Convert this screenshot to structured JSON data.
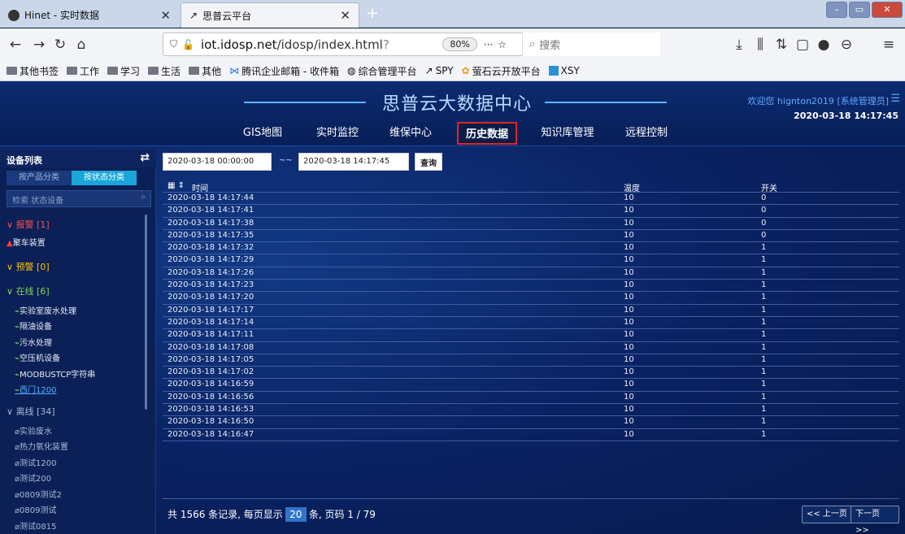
{
  "browser": {
    "tabs": [
      {
        "title": "Hinet - 实时数据"
      },
      {
        "title": "思普云平台"
      }
    ],
    "url_host": "iot.idosp.net",
    "url_path": "/idosp/index.html",
    "url_fade": "?",
    "zoom": "80%",
    "search_placeholder": "搜索",
    "bookmarks": [
      "其他书签",
      "工作",
      "学习",
      "生活",
      "其他",
      "腾讯企业邮箱 - 收件箱",
      "综合管理平台",
      "SPY",
      "萤石云开放平台",
      "XSY"
    ]
  },
  "header": {
    "title": "思普云大数据中心",
    "welcome": "欢迎您 hignton2019 [系统管理员]",
    "datetime": "2020-03-18 14:17:45"
  },
  "menu": [
    "GIS地图",
    "实时监控",
    "维保中心",
    "历史数据",
    "知识库管理",
    "远程控制"
  ],
  "sidebar": {
    "title": "设备列表",
    "seg": [
      "按产品分类",
      "按状态分类"
    ],
    "search_placeholder": "检索 状态设备",
    "groups": [
      {
        "label": "报警 [1]",
        "color": "#ff4d4d",
        "items": [
          "聚车装置"
        ]
      },
      {
        "label": "预警 [0]",
        "color": "#ffc107",
        "items": []
      },
      {
        "label": "在线 [6]",
        "color": "#7ed957",
        "items": [
          "实验室废水处理",
          "隔油设备",
          "污水处理",
          "空压机设备",
          "MODBUSTCP字符串",
          "西门1200"
        ]
      },
      {
        "label": "离线 [34]",
        "color": "#aab8d2",
        "items": [
          "实验废水",
          "热力氧化装置",
          "测试1200",
          "测试200",
          "0809测试2",
          "0809测试",
          "测试0815"
        ]
      }
    ]
  },
  "query": {
    "start": "2020-03-18 00:00:00",
    "sep": "~~",
    "end": "2020-03-18 14:17:45",
    "button": "查询"
  },
  "table": {
    "headers": [
      "时间",
      "温度",
      "开关"
    ],
    "rows": [
      [
        "2020-03-18 14:17:44",
        "10",
        "0"
      ],
      [
        "2020-03-18 14:17:41",
        "10",
        "0"
      ],
      [
        "2020-03-18 14:17:38",
        "10",
        "0"
      ],
      [
        "2020-03-18 14:17:35",
        "10",
        "0"
      ],
      [
        "2020-03-18 14:17:32",
        "10",
        "1"
      ],
      [
        "2020-03-18 14:17:29",
        "10",
        "1"
      ],
      [
        "2020-03-18 14:17:26",
        "10",
        "1"
      ],
      [
        "2020-03-18 14:17:23",
        "10",
        "1"
      ],
      [
        "2020-03-18 14:17:20",
        "10",
        "1"
      ],
      [
        "2020-03-18 14:17:17",
        "10",
        "1"
      ],
      [
        "2020-03-18 14:17:14",
        "10",
        "1"
      ],
      [
        "2020-03-18 14:17:11",
        "10",
        "1"
      ],
      [
        "2020-03-18 14:17:08",
        "10",
        "1"
      ],
      [
        "2020-03-18 14:17:05",
        "10",
        "1"
      ],
      [
        "2020-03-18 14:17:02",
        "10",
        "1"
      ],
      [
        "2020-03-18 14:16:59",
        "10",
        "1"
      ],
      [
        "2020-03-18 14:16:56",
        "10",
        "1"
      ],
      [
        "2020-03-18 14:16:53",
        "10",
        "1"
      ],
      [
        "2020-03-18 14:16:50",
        "10",
        "1"
      ],
      [
        "2020-03-18 14:16:47",
        "10",
        "1"
      ]
    ]
  },
  "footer": {
    "pre": "共 1566 条记录, 每页显示",
    "pagesize": "20",
    "post": "条, 页码 1 / 79",
    "prev": "<< 上一页",
    "next": "下一页 >>"
  }
}
